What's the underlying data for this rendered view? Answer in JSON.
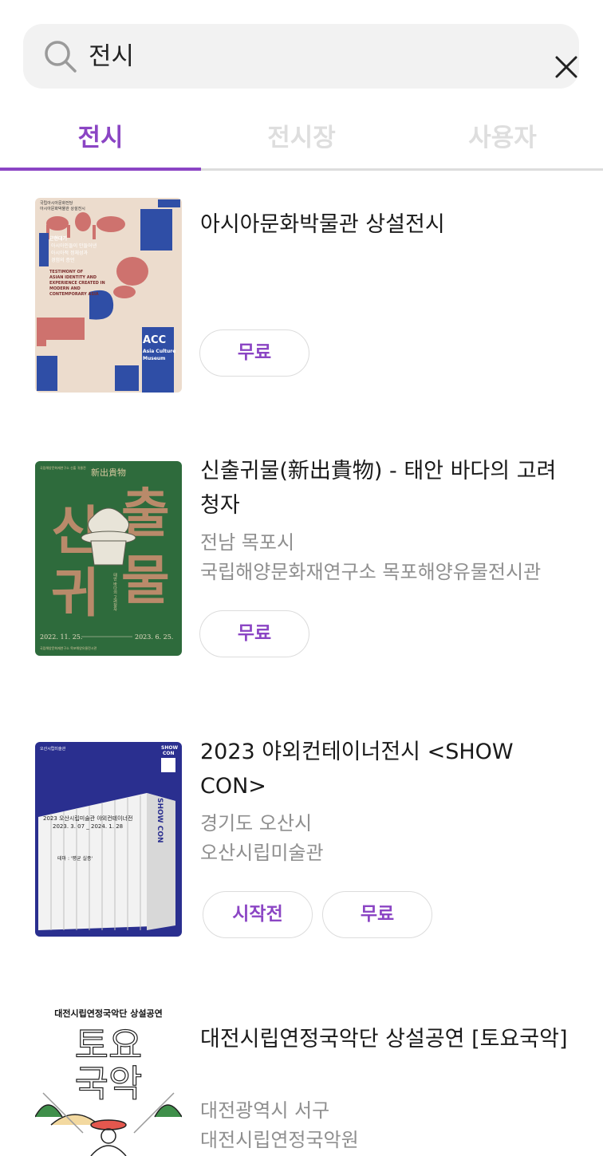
{
  "search": {
    "query": "전시"
  },
  "tabs": [
    {
      "label": "전시"
    },
    {
      "label": "전시장"
    },
    {
      "label": "사용자"
    }
  ],
  "colors": {
    "accent": "#8b45c4",
    "inactive_tab": "#dedede",
    "meta_text": "#8f8f8f",
    "search_bg": "#f2f2f2"
  },
  "icons": {
    "search": "search-icon",
    "clear": "close-icon"
  },
  "results": [
    {
      "title": "아시아문화박물관 상설전시",
      "location": "",
      "venue": "",
      "badges": [
        "무료"
      ],
      "poster": {
        "small_lines": [
          "국립아시아문화전당",
          "아시아문화박물관 상설전시"
        ],
        "headline": [
          "근현대기",
          "아시아인들이 만들어낸",
          "아시아적 정체성과",
          "경험의 증언"
        ],
        "english": [
          "TESTIMONY OF",
          "ASIAN IDENTITY AND",
          "EXPERIENCE CREATED IN",
          "MODERN AND",
          "CONTEMPORARY ASIA"
        ],
        "acc": "ACC",
        "museum": [
          "Asia Culture",
          "Museum"
        ]
      }
    },
    {
      "title": "신출귀물(新出貴物) - 태안 바다의 고려청자",
      "location": "전남 목포시",
      "venue": "국립해양문화재연구소 목포해양유물전시관",
      "badges": [
        "무료"
      ],
      "poster": {
        "top_left": "국립해양문화재연구소 신출 귀물전",
        "hanja": "新出貴物",
        "big": [
          "신",
          "귀",
          "출",
          "물"
        ],
        "vertical": "태안 바다의 고려청자",
        "start": "2022. 11. 25.",
        "end": "2023. 6. 25.",
        "bottom": "국립해양문화재연구소 목포해양유물전시관"
      }
    },
    {
      "title": "2023 야외컨테이너전시 <SHOW CON>",
      "location": "경기도 오산시",
      "venue": "오산시립미술관",
      "badges": [
        "시작전",
        "무료"
      ],
      "poster": {
        "brand": "오산시립미술관",
        "tag": [
          "SHOW",
          "CON"
        ],
        "heading": "2023 오산시립미술관 야외컨테이너전",
        "dates": "2023. 3. 07 _ 2024. 1. 28",
        "theme": "테마 : '평균 실종'",
        "vertical": "SHOW CON"
      }
    },
    {
      "title": "대전시립연정국악단 상설공연 [토요국악]",
      "location": "대전광역시 서구",
      "venue": "대전시립연정국악원",
      "badges": [],
      "poster": {
        "top": "대전시립연정국악단 상설공연",
        "big": [
          "토요",
          "국악"
        ]
      }
    }
  ]
}
